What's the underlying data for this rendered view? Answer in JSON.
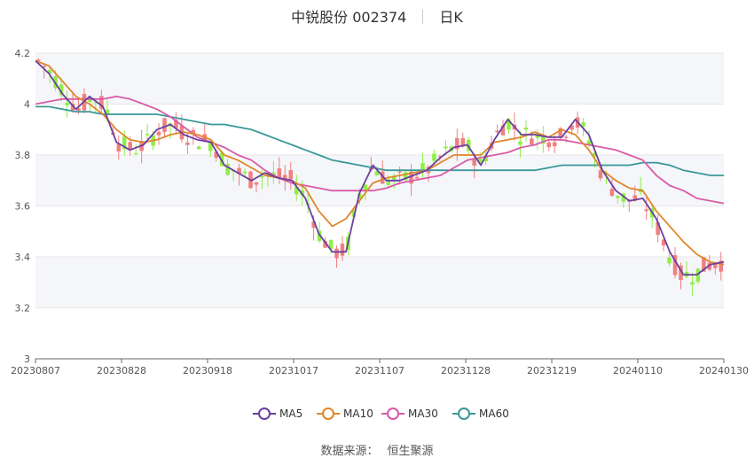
{
  "header": {
    "stock": "中锐股份 002374",
    "period": "日K"
  },
  "source": {
    "label": "数据来源：",
    "value": "恒生聚源"
  },
  "colors": {
    "up": "#f08080",
    "down": "#90ee44",
    "MA5": "#6b3fa0",
    "MA10": "#e0862a",
    "MA30": "#d85aa8",
    "MA60": "#3a9898"
  },
  "chart_data": {
    "type": "candlestick",
    "title": "中锐股份 002374 日K",
    "y_ticks": [
      "3",
      "3.2",
      "3.4",
      "3.6",
      "3.8",
      "4",
      "4.2"
    ],
    "ylim": [
      3.0,
      4.2
    ],
    "x_tick_labels": [
      "20230807",
      "20230828",
      "20230918",
      "20231017",
      "20231107",
      "20231128",
      "20231219",
      "20240110",
      "20240130"
    ],
    "grid": true,
    "legend_position": "bottom",
    "series": [
      {
        "name": "MA5"
      },
      {
        "name": "MA10"
      },
      {
        "name": "MA30"
      },
      {
        "name": "MA60"
      }
    ],
    "ma_values": {
      "MA5": [
        4.17,
        4.12,
        4.04,
        3.98,
        4.03,
        3.99,
        3.85,
        3.82,
        3.84,
        3.9,
        3.92,
        3.88,
        3.86,
        3.85,
        3.76,
        3.73,
        3.7,
        3.73,
        3.71,
        3.7,
        3.63,
        3.49,
        3.42,
        3.42,
        3.65,
        3.76,
        3.7,
        3.7,
        3.72,
        3.74,
        3.79,
        3.83,
        3.84,
        3.76,
        3.86,
        3.94,
        3.88,
        3.88,
        3.87,
        3.87,
        3.94,
        3.88,
        3.74,
        3.66,
        3.62,
        3.63,
        3.55,
        3.42,
        3.33,
        3.33,
        3.37,
        3.38
      ],
      "MA10": [
        4.17,
        4.15,
        4.09,
        4.03,
        4.0,
        3.96,
        3.9,
        3.86,
        3.85,
        3.86,
        3.88,
        3.89,
        3.88,
        3.86,
        3.8,
        3.78,
        3.75,
        3.72,
        3.71,
        3.7,
        3.67,
        3.58,
        3.52,
        3.55,
        3.62,
        3.69,
        3.71,
        3.72,
        3.73,
        3.74,
        3.77,
        3.8,
        3.8,
        3.8,
        3.85,
        3.86,
        3.87,
        3.89,
        3.87,
        3.9,
        3.88,
        3.82,
        3.74,
        3.7,
        3.67,
        3.66,
        3.58,
        3.52,
        3.46,
        3.41,
        3.38,
        3.37
      ],
      "MA30": [
        4.0,
        4.01,
        4.02,
        4.02,
        4.02,
        4.02,
        4.03,
        4.02,
        4.0,
        3.98,
        3.95,
        3.91,
        3.87,
        3.85,
        3.83,
        3.8,
        3.78,
        3.74,
        3.71,
        3.69,
        3.68,
        3.67,
        3.66,
        3.66,
        3.66,
        3.66,
        3.67,
        3.69,
        3.7,
        3.71,
        3.72,
        3.75,
        3.78,
        3.79,
        3.8,
        3.81,
        3.83,
        3.84,
        3.86,
        3.86,
        3.85,
        3.84,
        3.83,
        3.82,
        3.8,
        3.78,
        3.72,
        3.68,
        3.66,
        3.63,
        3.62,
        3.61
      ],
      "MA60": [
        3.99,
        3.99,
        3.98,
        3.97,
        3.97,
        3.96,
        3.96,
        3.96,
        3.96,
        3.96,
        3.95,
        3.94,
        3.93,
        3.92,
        3.92,
        3.91,
        3.9,
        3.88,
        3.86,
        3.84,
        3.82,
        3.8,
        3.78,
        3.77,
        3.76,
        3.75,
        3.74,
        3.74,
        3.74,
        3.74,
        3.74,
        3.74,
        3.74,
        3.74,
        3.74,
        3.74,
        3.74,
        3.74,
        3.75,
        3.76,
        3.76,
        3.76,
        3.76,
        3.76,
        3.76,
        3.77,
        3.77,
        3.76,
        3.74,
        3.73,
        3.72,
        3.72
      ]
    }
  }
}
